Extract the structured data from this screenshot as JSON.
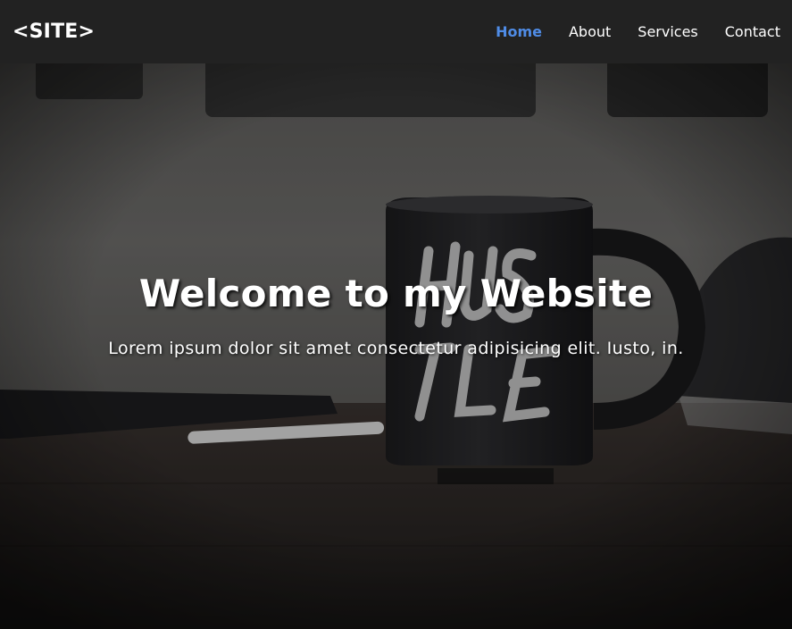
{
  "navbar": {
    "logo": "<SITE>",
    "links": [
      {
        "label": "Home",
        "active": true
      },
      {
        "label": "About",
        "active": false
      },
      {
        "label": "Services",
        "active": false
      },
      {
        "label": "Contact",
        "active": false
      }
    ]
  },
  "hero": {
    "title": "Welcome to my Website",
    "subtitle": "Lorem ipsum dolor sit amet consectetur adipisicing elit. Iusto, in.",
    "background_image": "coffee-mug-photo"
  },
  "colors": {
    "navbar_bg": "#222222",
    "active_link": "#4f8ce6",
    "text": "#ffffff"
  }
}
